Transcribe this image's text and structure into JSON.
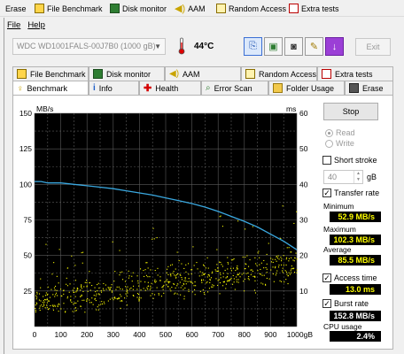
{
  "topbar": {
    "items": [
      {
        "label": "Erase",
        "icon": "erase-icon"
      },
      {
        "label": "File Benchmark",
        "icon": "file-benchmark-icon"
      },
      {
        "label": "Disk monitor",
        "icon": "disk-monitor-icon"
      },
      {
        "label": "AAM",
        "icon": "speaker-icon"
      },
      {
        "label": "Random Access",
        "icon": "random-access-icon"
      },
      {
        "label": "Extra tests",
        "icon": "extra-tests-icon"
      }
    ]
  },
  "menu": {
    "file": "File",
    "help": "Help"
  },
  "drive": {
    "selected": "WDC WD1001FALS-00J7B0 (1000 gB)"
  },
  "temperature": "44°C",
  "toolbar": {
    "exit_label": "Exit"
  },
  "tabs_top": [
    {
      "label": "File Benchmark",
      "icon": "file-benchmark-icon"
    },
    {
      "label": "Disk monitor",
      "icon": "disk-monitor-icon"
    },
    {
      "label": "AAM",
      "icon": "speaker-icon"
    },
    {
      "label": "Random Access",
      "icon": "random-access-icon"
    },
    {
      "label": "Extra tests",
      "icon": "extra-tests-icon"
    }
  ],
  "tabs_bottom": [
    {
      "label": "Benchmark",
      "icon": "benchmark-icon",
      "active": true
    },
    {
      "label": "Info",
      "icon": "info-icon"
    },
    {
      "label": "Health",
      "icon": "health-cross-icon"
    },
    {
      "label": "Error Scan",
      "icon": "magnifier-icon"
    },
    {
      "label": "Folder Usage",
      "icon": "folder-icon"
    },
    {
      "label": "Erase",
      "icon": "erase-icon"
    }
  ],
  "side": {
    "stop_label": "Stop",
    "read_label": "Read",
    "write_label": "Write",
    "short_stroke_label": "Short stroke",
    "short_stroke_value": "40",
    "short_stroke_unit": "gB",
    "transfer_rate_label": "Transfer rate",
    "minimum_label": "Minimum",
    "minimum_value": "52.9 MB/s",
    "maximum_label": "Maximum",
    "maximum_value": "102.3 MB/s",
    "average_label": "Average",
    "average_value": "85.5 MB/s",
    "access_time_label": "Access time",
    "access_time_value": "13.0 ms",
    "burst_rate_label": "Burst rate",
    "burst_rate_value": "152.8 MB/s",
    "cpu_usage_label": "CPU usage",
    "cpu_usage_value": "2.4%"
  },
  "colors": {
    "transfer_line": "#3aa8e0",
    "access_points": "#ffff00",
    "plot_bg": "#000000",
    "grid": "#5a5a5a"
  },
  "chart_data": {
    "type": "line",
    "y_left_label": "MB/s",
    "y_right_label": "ms",
    "ylim_left": [
      0,
      150
    ],
    "ylim_right": [
      0,
      60
    ],
    "y_left_ticks": [
      "0",
      "25",
      "50",
      "75",
      "100",
      "125",
      "150"
    ],
    "y_right_ticks": [
      "0",
      "10",
      "20",
      "30",
      "40",
      "50",
      "60"
    ],
    "xlim": [
      0,
      1000
    ],
    "x_ticks": [
      "0",
      "100",
      "200",
      "300",
      "400",
      "500",
      "600",
      "700",
      "800",
      "900",
      "1000gB"
    ],
    "grid": true,
    "series": [
      {
        "name": "Transfer rate",
        "x": [
          0,
          25,
          50,
          100,
          150,
          200,
          250,
          300,
          350,
          400,
          450,
          500,
          550,
          600,
          650,
          700,
          750,
          800,
          850,
          900,
          950,
          1000
        ],
        "y": [
          102,
          102,
          101,
          101,
          100,
          99,
          98,
          97,
          95.5,
          94,
          92.5,
          90.5,
          88.5,
          86.5,
          84,
          81,
          77.5,
          74,
          70,
          65,
          60,
          54
        ]
      },
      {
        "name": "Access time",
        "x": [
          0,
          100,
          200,
          300,
          400,
          500,
          600,
          700,
          800,
          900,
          1000
        ],
        "y": [
          7,
          8.5,
          9.5,
          10.5,
          11.5,
          12.5,
          13.5,
          14.5,
          15.5,
          16.5,
          17.5
        ]
      }
    ]
  }
}
